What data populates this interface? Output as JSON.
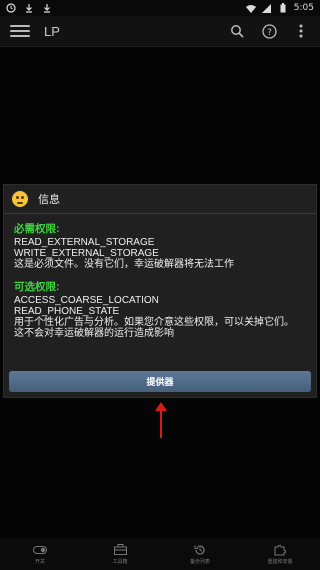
{
  "status_bar": {
    "icons_left": [
      "alarm-icon",
      "download-icon",
      "download-icon"
    ],
    "icons_right": [
      "wifi-icon",
      "signal-icon",
      "battery-icon"
    ],
    "time": "5:05"
  },
  "app_bar": {
    "title": "LP",
    "actions": [
      "search-icon",
      "help-icon",
      "more-icon"
    ]
  },
  "dialog": {
    "title": "信息",
    "required": {
      "heading": "必需权限:",
      "lines": [
        "READ_EXTERNAL_STORAGE",
        "WRITE_EXTERNAL_STORAGE",
        "这是必须文件。没有它们，幸运破解器将无法工作"
      ]
    },
    "optional": {
      "heading": "可选权限:",
      "lines": [
        "ACCESS_COARSE_LOCATION",
        "READ_PHONE_STATE",
        "用于个性化广告与分析。如果您介意这些权限，可以关掉它们。",
        "这不会对幸运破解器的运行造成影响"
      ]
    },
    "button_label": "提供器"
  },
  "annotation": {
    "arrow_color": "#d41c1c"
  },
  "bottom_nav": {
    "items": [
      {
        "label": "开关",
        "icon": "toggle-icon"
      },
      {
        "label": "工具箱",
        "icon": "toolbox-icon"
      },
      {
        "label": "备份列表",
        "icon": "history-icon"
      },
      {
        "label": "重建和安装",
        "icon": "puzzle-icon"
      }
    ]
  },
  "colors": {
    "accent_green": "#3ed33e",
    "button": "#5d7896"
  }
}
